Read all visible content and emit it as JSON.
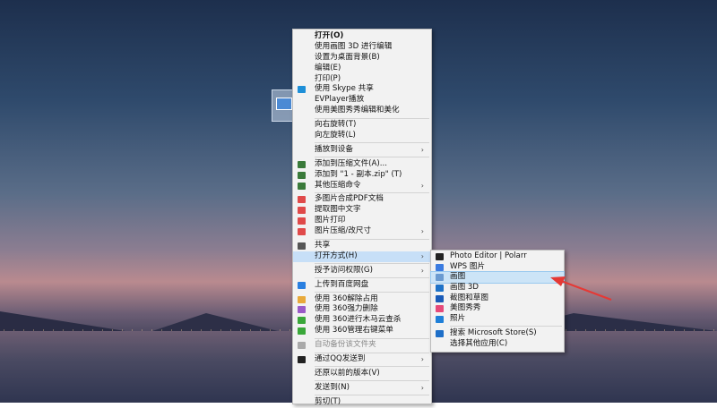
{
  "menu": {
    "items": [
      {
        "label": "打开(O)",
        "bold": true
      },
      {
        "label": "使用画图 3D 进行编辑"
      },
      {
        "label": "设置为桌面背景(B)"
      },
      {
        "label": "编辑(E)"
      },
      {
        "label": "打印(P)"
      },
      {
        "label": "使用 Skype 共享",
        "icon": "skype-icon",
        "color": "#1e8fd8"
      },
      {
        "label": "EVPlayer播放"
      },
      {
        "label": "使用美图秀秀编辑和美化"
      },
      {
        "sep": true
      },
      {
        "label": "向右旋转(T)"
      },
      {
        "label": "向左旋转(L)"
      },
      {
        "sep": true
      },
      {
        "label": "播放到设备",
        "submenu": true
      },
      {
        "sep": true
      },
      {
        "label": "添加到压缩文件(A)...",
        "icon": "archive-icon",
        "color": "#3a7a3a"
      },
      {
        "label": "添加到 \"1 - 副本.zip\" (T)",
        "icon": "archive-icon",
        "color": "#3a7a3a"
      },
      {
        "label": "其他压缩命令",
        "icon": "archive-icon",
        "color": "#3a7a3a",
        "submenu": true
      },
      {
        "sep": true
      },
      {
        "label": "多图片合成PDF文档",
        "icon": "pdf-icon",
        "color": "#e04a4a"
      },
      {
        "label": "提取图中文字",
        "icon": "ocr-icon",
        "color": "#e04a4a"
      },
      {
        "label": "图片打印",
        "icon": "printer-icon",
        "color": "#e04a4a"
      },
      {
        "label": "图片压缩/改尺寸",
        "icon": "compress-icon",
        "color": "#e04a4a",
        "submenu": true
      },
      {
        "sep": true
      },
      {
        "label": "共享",
        "icon": "share-icon",
        "color": "#555555"
      },
      {
        "label": "打开方式(H)",
        "submenu": true,
        "highlight": true
      },
      {
        "sep": true
      },
      {
        "label": "授予访问权限(G)",
        "submenu": true
      },
      {
        "sep": true
      },
      {
        "label": "上传到百度网盘",
        "icon": "baidu-cloud-icon",
        "color": "#2a7fe0"
      },
      {
        "sep": true
      },
      {
        "label": "使用 360解除占用",
        "icon": "360-unlock-icon",
        "color": "#e8a93a"
      },
      {
        "label": "使用 360强力删除",
        "icon": "360-delete-icon",
        "color": "#9a5ac8"
      },
      {
        "label": "使用 360进行木马云查杀",
        "icon": "360-scan-icon",
        "color": "#3aa83a"
      },
      {
        "label": "使用 360管理右键菜单",
        "icon": "360-manage-icon",
        "color": "#3aa83a"
      },
      {
        "sep": true
      },
      {
        "label": "自动备份该文件夹",
        "icon": "backup-icon",
        "color": "#aaaaaa",
        "disabled": true
      },
      {
        "sep": true
      },
      {
        "label": "通过QQ发送到",
        "icon": "qq-icon",
        "color": "#222222",
        "submenu": true
      },
      {
        "sep": true
      },
      {
        "label": "还原以前的版本(V)"
      },
      {
        "sep": true
      },
      {
        "label": "发送到(N)",
        "submenu": true
      },
      {
        "sep": true
      },
      {
        "label": "剪切(T)"
      }
    ]
  },
  "submenu": {
    "items": [
      {
        "label": "Photo Editor | Polarr",
        "icon": "polarr-icon",
        "color": "#222222"
      },
      {
        "label": "WPS 图片",
        "icon": "wps-photo-icon",
        "color": "#3b7be0"
      },
      {
        "label": "画图",
        "icon": "paint-icon",
        "color": "#6b9bd1",
        "highlight": true
      },
      {
        "label": "画图 3D",
        "icon": "paint3d-icon",
        "color": "#1e72c8"
      },
      {
        "label": "截图和草图",
        "icon": "snip-sketch-icon",
        "color": "#1a5bb8"
      },
      {
        "label": "美图秀秀",
        "icon": "meitu-icon",
        "color": "#e64a7a"
      },
      {
        "label": "照片",
        "icon": "photos-icon",
        "color": "#1e7fd8"
      },
      {
        "sep": true
      },
      {
        "label": "搜索 Microsoft Store(S)",
        "icon": "store-icon",
        "color": "#1e6fc8"
      },
      {
        "label": "选择其他应用(C)"
      }
    ]
  },
  "colors": {
    "highlight": "#c7dff7",
    "annotation_arrow": "#e53935"
  }
}
